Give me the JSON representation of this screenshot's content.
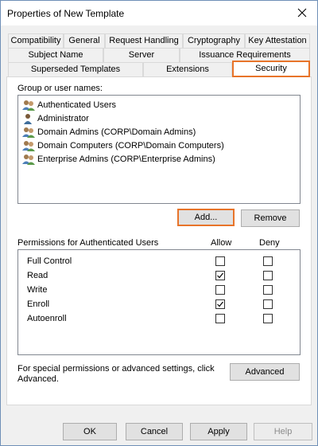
{
  "window": {
    "title": "Properties of New Template"
  },
  "tabs": {
    "row1": [
      "Compatibility",
      "General",
      "Request Handling",
      "Cryptography",
      "Key Attestation"
    ],
    "row2": [
      "Subject Name",
      "Server",
      "Issuance Requirements"
    ],
    "row3": [
      "Superseded Templates",
      "Extensions",
      "Security"
    ],
    "active": "Security"
  },
  "security": {
    "group_label": "Group or user names:",
    "principals": [
      {
        "name": "Authenticated Users",
        "icon": "users-group-icon"
      },
      {
        "name": "Administrator",
        "icon": "user-icon"
      },
      {
        "name": "Domain Admins (CORP\\Domain Admins)",
        "icon": "users-group-icon"
      },
      {
        "name": "Domain Computers (CORP\\Domain Computers)",
        "icon": "users-group-icon"
      },
      {
        "name": "Enterprise Admins (CORP\\Enterprise Admins)",
        "icon": "users-group-icon"
      }
    ],
    "add_button": "Add...",
    "remove_button": "Remove",
    "permissions_label": "Permissions for Authenticated Users",
    "allow_header": "Allow",
    "deny_header": "Deny",
    "permissions": [
      {
        "name": "Full Control",
        "allow": false,
        "deny": false
      },
      {
        "name": "Read",
        "allow": true,
        "deny": false
      },
      {
        "name": "Write",
        "allow": false,
        "deny": false
      },
      {
        "name": "Enroll",
        "allow": true,
        "deny": false
      },
      {
        "name": "Autoenroll",
        "allow": false,
        "deny": false
      }
    ],
    "advanced_text_line1": "For special permissions or advanced settings, click",
    "advanced_text_line2": "Advanced.",
    "advanced_button": "Advanced"
  },
  "footer": {
    "ok": "OK",
    "cancel": "Cancel",
    "apply": "Apply",
    "help": "Help"
  },
  "colors": {
    "highlight": "#e8742a",
    "window_border": "#6f8fb7",
    "chrome": "#f0f0f0"
  }
}
